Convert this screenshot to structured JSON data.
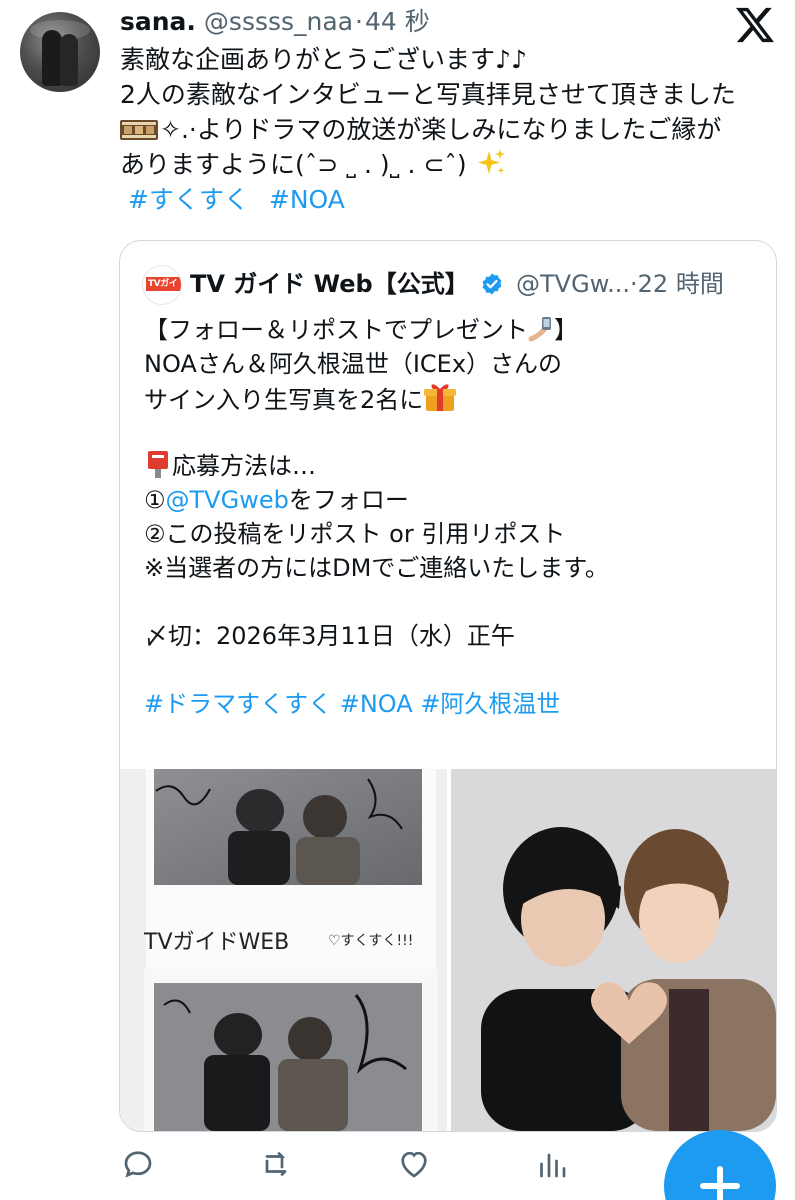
{
  "post": {
    "display_name": "sana.",
    "handle": "@sssss_naa",
    "separator": "·",
    "time": "44 秒",
    "lines": [
      "素敵な企画ありがとうございます♪♪",
      "2人の素敵なインタビューと写真拝見させて頂きました"
    ],
    "line3_after_emoji": "✧.·よりドラマの放送が楽しみになりましたご縁が",
    "line4": "ありますように(ˆ⊃ ˽ . )˽ . ⊂ˆ)",
    "hashtags": [
      "#すくすく",
      "#NOA"
    ]
  },
  "quote": {
    "display_name": "TV ガイド Web【公式】",
    "handle": "@TVGw...",
    "separator": "·",
    "time": "22 時間",
    "avatar_text": "TVガイド",
    "line1": "【フォロー＆リポストでプレゼント",
    "line1_end": "】",
    "line2": "NOAさん＆阿久根温世（ICEx）さんの",
    "line3": "サイン入り生写真を2名に",
    "line4": "応募方法は…",
    "line5_prefix": "①",
    "line5_link": "@TVGweb",
    "line5_suffix": "をフォロー",
    "line6": "②この投稿をリポスト or 引用リポスト",
    "line7": "※当選者の方にはDMでご連絡いたします。",
    "line8": "〆切：2026年3月11日（水）正午",
    "hashtags": "#ドラマすくすく #NOA #阿久根温世"
  },
  "images": {
    "left_caption": "TVガイドWEB",
    "left_caption2": "♡すくすく!!!"
  },
  "actions": {
    "reply": "reply-icon",
    "repost": "repost-icon",
    "like": "heart-icon",
    "views": "views-icon",
    "compose": "plus-icon"
  },
  "colors": {
    "accent": "#1d9bf0",
    "text": "#0f1419",
    "secondary": "#536471",
    "border": "#cfd9de"
  }
}
